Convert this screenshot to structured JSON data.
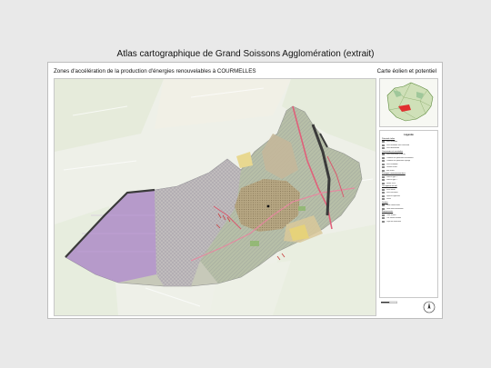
{
  "page": {
    "title": "Atlas cartographique de Grand Soissons Agglomération (extrait)"
  },
  "sheet": {
    "subtitle": "Zones d'accélération de la production d'énergies renouvelables à COURMELLES",
    "theme": "Carte éolien et potentiel"
  },
  "legend": {
    "title": "Légende",
    "items": [
      {
        "type": "head",
        "label": "Potentiel éolien"
      },
      {
        "type": "item",
        "label": "Zone favorable",
        "color": "#f4f0d8"
      },
      {
        "type": "item",
        "label": "Zone favorable sous contrainte",
        "color": "#efe2c0"
      },
      {
        "type": "item",
        "label": "Zone défavorable",
        "color": "#e9c9c0"
      },
      {
        "type": "head",
        "label": "Contraintes et servitudes"
      },
      {
        "type": "item",
        "label": "Zone d'exclusion (500 m)",
        "color": "#d8d0e8"
      },
      {
        "type": "item",
        "label": "Périmètre de protection monuments",
        "color": "#e8b0b8"
      },
      {
        "type": "item",
        "label": "Périmètre de protection captage",
        "color": "#f0c0a8"
      },
      {
        "type": "item",
        "label": "Zone inondable",
        "color": "#b9d3e8"
      },
      {
        "type": "item",
        "label": "Réseau routier",
        "color": "#d05050"
      },
      {
        "type": "item",
        "label": "Voie ferrée",
        "color": "#555555"
      },
      {
        "type": "head",
        "label": "Zonages environnementaux"
      },
      {
        "type": "item",
        "label": "ZNIEFF type 1",
        "color": "#b6d6a8"
      },
      {
        "type": "item",
        "label": "ZNIEFF type 2",
        "color": "#cfe3b4"
      },
      {
        "type": "item",
        "label": "Natura 2000",
        "color": "#9fc79a"
      },
      {
        "type": "head",
        "label": "Occupation du sol"
      },
      {
        "type": "item",
        "label": "Tissu urbain",
        "color": "#c9b8a0"
      },
      {
        "type": "item",
        "label": "Zone d'activités",
        "color": "#b8a8c8"
      },
      {
        "type": "item",
        "label": "Espaces agricoles",
        "color": "#f2ecc8"
      },
      {
        "type": "item",
        "label": "Forêts",
        "color": "#a8c898"
      },
      {
        "type": "head",
        "label": "Limites"
      },
      {
        "type": "item",
        "label": "Limite communale",
        "color": "#ffffff"
      },
      {
        "type": "item",
        "label": "Limite intercommunale",
        "color": "#ffffff"
      },
      {
        "type": "head",
        "label": "Équipements"
      },
      {
        "type": "item",
        "label": "Poste source",
        "color": "#333333"
      },
      {
        "type": "item",
        "label": "Parc éolien existant",
        "color": "#7a5ea0"
      },
      {
        "type": "item",
        "label": "Projet en instruction",
        "color": "#a08cc8"
      }
    ]
  },
  "colors": {
    "purple_zone": "#b08ad0",
    "urban": "#b7a47e",
    "hatch": "#9a9aa8",
    "field": "#dfe6d2",
    "road": "#e0607a",
    "railway": "#3a3a3a"
  }
}
